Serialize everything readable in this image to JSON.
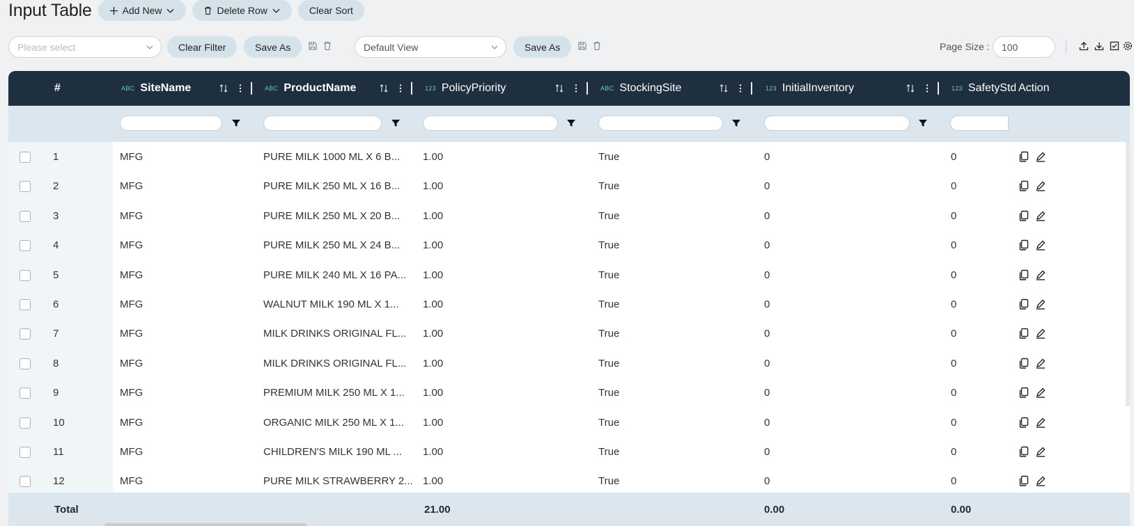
{
  "toolbar": {
    "title": "Input Table",
    "add_new": "Add New",
    "delete_row": "Delete Row",
    "clear_sort": "Clear Sort"
  },
  "filters": {
    "select_placeholder": "Please select",
    "clear_filter": "Clear Filter",
    "save_as_1": "Save As",
    "view_value": "Default View",
    "save_as_2": "Save As",
    "page_size_label": "Page Size :",
    "page_size_value": "100"
  },
  "columns": [
    {
      "type": "ABC",
      "label": "SiteName"
    },
    {
      "type": "ABC",
      "label": "ProductName"
    },
    {
      "type": "123",
      "label": "PolicyPriority"
    },
    {
      "type": "ABC",
      "label": "StockingSite"
    },
    {
      "type": "123",
      "label": "InitialInventory"
    },
    {
      "type": "123",
      "label": "SafetyStd"
    }
  ],
  "header": {
    "index": "#",
    "action": "Action"
  },
  "rows": [
    {
      "n": "1",
      "site": "MFG",
      "product": "PURE MILK 1000 ML X 6 B...",
      "priority": "1.00",
      "stocking": "True",
      "initial": "0",
      "safety": "0"
    },
    {
      "n": "2",
      "site": "MFG",
      "product": "PURE MILK 250 ML X 16 B...",
      "priority": "1.00",
      "stocking": "True",
      "initial": "0",
      "safety": "0"
    },
    {
      "n": "3",
      "site": "MFG",
      "product": "PURE MILK 250 ML X 20 B...",
      "priority": "1.00",
      "stocking": "True",
      "initial": "0",
      "safety": "0"
    },
    {
      "n": "4",
      "site": "MFG",
      "product": "PURE MILK 250 ML X 24 B...",
      "priority": "1.00",
      "stocking": "True",
      "initial": "0",
      "safety": "0"
    },
    {
      "n": "5",
      "site": "MFG",
      "product": "PURE MILK 240 ML X 16 PA...",
      "priority": "1.00",
      "stocking": "True",
      "initial": "0",
      "safety": "0"
    },
    {
      "n": "6",
      "site": "MFG",
      "product": "WALNUT MILK 190 ML X 1...",
      "priority": "1.00",
      "stocking": "True",
      "initial": "0",
      "safety": "0"
    },
    {
      "n": "7",
      "site": "MFG",
      "product": "MILK DRINKS ORIGINAL FL...",
      "priority": "1.00",
      "stocking": "True",
      "initial": "0",
      "safety": "0"
    },
    {
      "n": "8",
      "site": "MFG",
      "product": "MILK DRINKS ORIGINAL FL...",
      "priority": "1.00",
      "stocking": "True",
      "initial": "0",
      "safety": "0"
    },
    {
      "n": "9",
      "site": "MFG",
      "product": "PREMIUM MILK 250 ML X 1...",
      "priority": "1.00",
      "stocking": "True",
      "initial": "0",
      "safety": "0"
    },
    {
      "n": "10",
      "site": "MFG",
      "product": "ORGANIC MILK 250 ML X 1...",
      "priority": "1.00",
      "stocking": "True",
      "initial": "0",
      "safety": "0"
    },
    {
      "n": "11",
      "site": "MFG",
      "product": "CHILDREN'S MILK 190 ML ...",
      "priority": "1.00",
      "stocking": "True",
      "initial": "0",
      "safety": "0"
    },
    {
      "n": "12",
      "site": "MFG",
      "product": "PURE MILK STRAWBERRY 2...",
      "priority": "1.00",
      "stocking": "True",
      "initial": "0",
      "safety": "0"
    }
  ],
  "totals": {
    "label": "Total",
    "priority": "21.00",
    "initial": "0.00",
    "safety": "0.00"
  }
}
